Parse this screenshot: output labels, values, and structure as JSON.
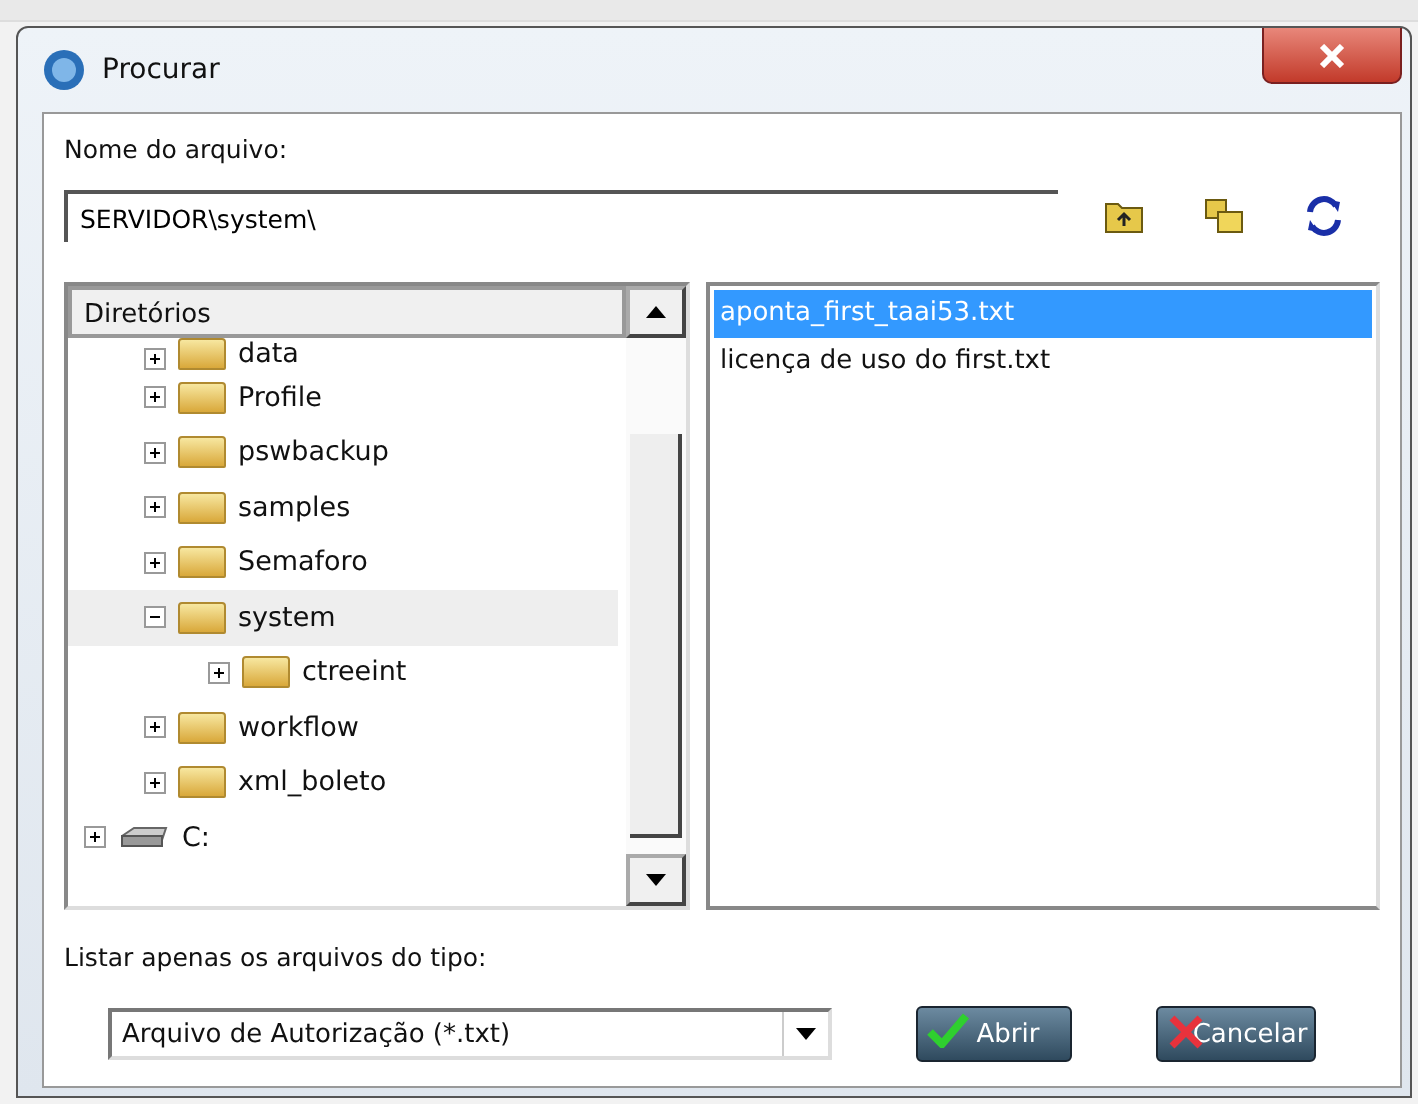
{
  "window": {
    "title": "Procurar"
  },
  "filename": {
    "label": "Nome do arquivo:",
    "value": "SERVIDOR\\system\\"
  },
  "directories": {
    "header": "Diretórios",
    "tree": [
      {
        "kind": "group",
        "children": [
          {
            "label": "data",
            "expanded": false,
            "selected": false
          },
          {
            "label": "Profile",
            "expanded": false,
            "selected": false
          },
          {
            "label": "pswbackup",
            "expanded": false,
            "selected": false
          },
          {
            "label": "samples",
            "expanded": false,
            "selected": false
          },
          {
            "label": "Semaforo",
            "expanded": false,
            "selected": false
          },
          {
            "label": "system",
            "expanded": true,
            "selected": true,
            "children": [
              {
                "label": "ctreeint",
                "expanded": false,
                "selected": false
              }
            ]
          },
          {
            "label": "workflow",
            "expanded": false,
            "selected": false
          },
          {
            "label": "xml_boleto",
            "expanded": false,
            "selected": false
          }
        ]
      },
      {
        "label": "C:",
        "kind": "drive",
        "expanded": false,
        "selected": false
      }
    ]
  },
  "files": [
    {
      "name": "aponta_first_taai53.txt",
      "selected": true
    },
    {
      "name": "licença de uso do first.txt",
      "selected": false
    }
  ],
  "filetype": {
    "label": "Listar apenas os arquivos do tipo:",
    "value": "Arquivo de Autorização (*.txt)"
  },
  "buttons": [
    {
      "label": "Abrir",
      "kind": "ok"
    },
    {
      "label": "Cancelar",
      "kind": "cancel"
    }
  ]
}
